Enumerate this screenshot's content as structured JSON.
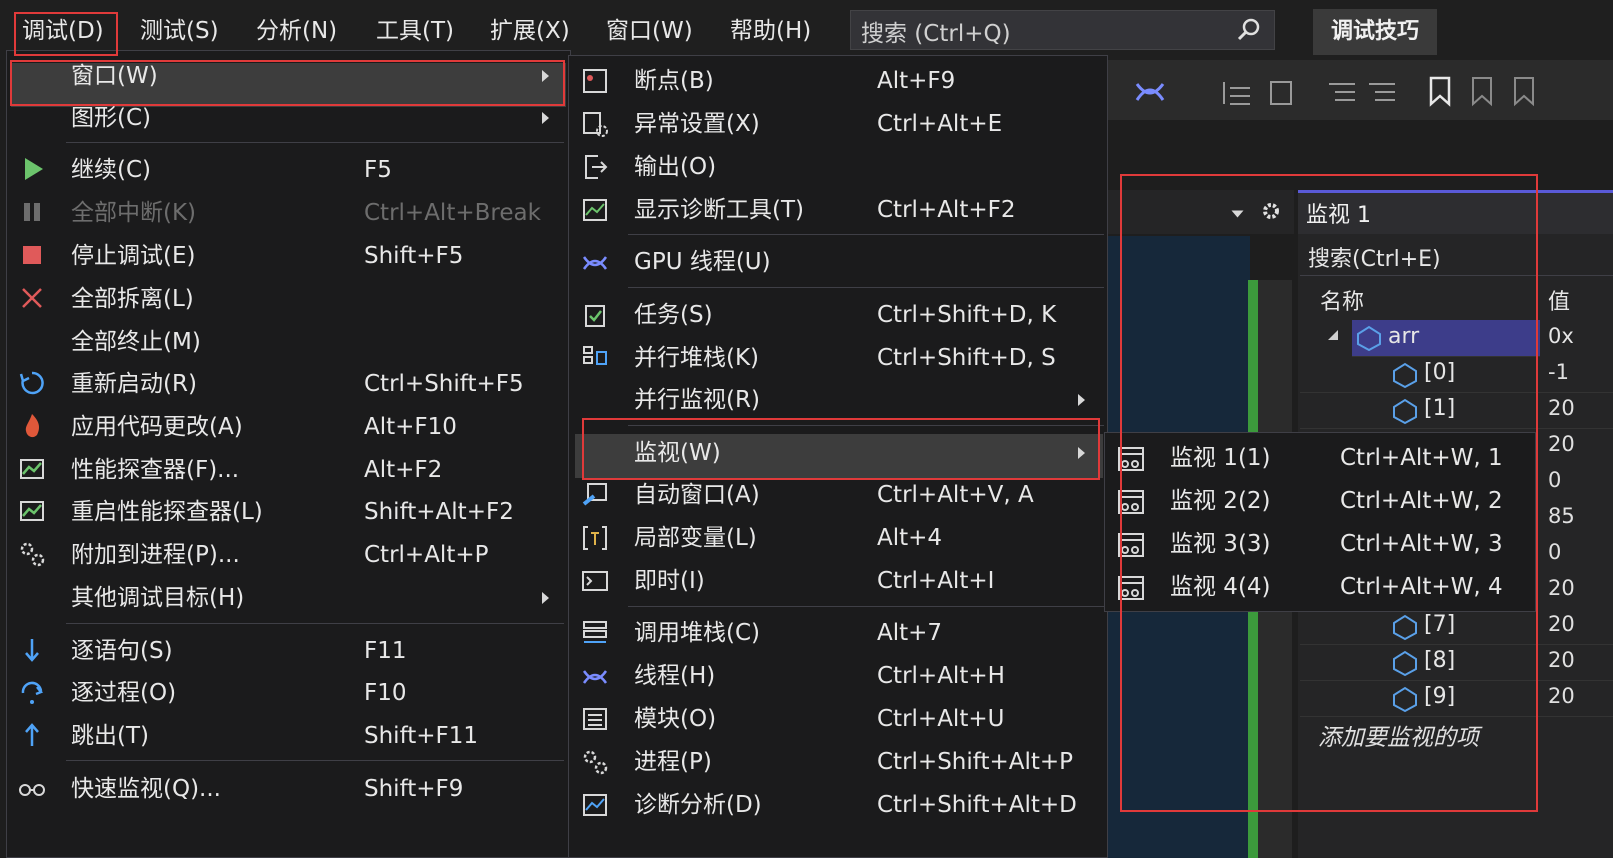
{
  "menubar": {
    "items": [
      "调试(D)",
      "测试(S)",
      "分析(N)",
      "工具(T)",
      "扩展(X)",
      "窗口(W)",
      "帮助(H)"
    ],
    "search_placeholder": "搜索 (Ctrl+Q)",
    "tips_button": "调试技巧"
  },
  "debug_menu": {
    "items": [
      {
        "label": "窗口(W)",
        "shortcut": "",
        "submenu": true,
        "icon": "none"
      },
      {
        "label": "图形(C)",
        "shortcut": "",
        "submenu": true,
        "icon": "none"
      },
      {
        "label": "继续(C)",
        "shortcut": "F5",
        "icon": "play-icon"
      },
      {
        "label": "全部中断(K)",
        "shortcut": "Ctrl+Alt+Break",
        "disabled": true,
        "icon": "pause-icon"
      },
      {
        "label": "停止调试(E)",
        "shortcut": "Shift+F5",
        "icon": "stop-icon"
      },
      {
        "label": "全部拆离(L)",
        "shortcut": "",
        "icon": "detach-x-icon"
      },
      {
        "label": "全部终止(M)",
        "shortcut": "",
        "icon": "none"
      },
      {
        "label": "重新启动(R)",
        "shortcut": "Ctrl+Shift+F5",
        "icon": "restart-icon"
      },
      {
        "label": "应用代码更改(A)",
        "shortcut": "Alt+F10",
        "icon": "hot-reload-icon"
      },
      {
        "label": "性能探查器(F)...",
        "shortcut": "Alt+F2",
        "icon": "profiler-icon"
      },
      {
        "label": "重启性能探查器(L)",
        "shortcut": "Shift+Alt+F2",
        "icon": "profiler-restart-icon"
      },
      {
        "label": "附加到进程(P)...",
        "shortcut": "Ctrl+Alt+P",
        "icon": "gears-icon"
      },
      {
        "label": "其他调试目标(H)",
        "shortcut": "",
        "submenu": true,
        "icon": "none"
      },
      {
        "label": "逐语句(S)",
        "shortcut": "F11",
        "icon": "step-into-icon"
      },
      {
        "label": "逐过程(O)",
        "shortcut": "F10",
        "icon": "step-over-icon"
      },
      {
        "label": "跳出(T)",
        "shortcut": "Shift+F11",
        "icon": "step-out-icon"
      },
      {
        "label": "快速监视(Q)...",
        "shortcut": "Shift+F9",
        "icon": "glasses-icon"
      }
    ]
  },
  "window_submenu": {
    "items": [
      {
        "label": "断点(B)",
        "shortcut": "Alt+F9",
        "icon": "breakpoints-icon"
      },
      {
        "label": "异常设置(X)",
        "shortcut": "Ctrl+Alt+E",
        "icon": "exception-settings-icon"
      },
      {
        "label": "输出(O)",
        "shortcut": "",
        "icon": "output-icon"
      },
      {
        "label": "显示诊断工具(T)",
        "shortcut": "Ctrl+Alt+F2",
        "icon": "diagnostics-icon"
      },
      {
        "label": "GPU 线程(U)",
        "shortcut": "",
        "icon": "gpu-threads-icon"
      },
      {
        "label": "任务(S)",
        "shortcut": "Ctrl+Shift+D, K",
        "icon": "tasks-icon"
      },
      {
        "label": "并行堆栈(K)",
        "shortcut": "Ctrl+Shift+D, S",
        "icon": "parallel-stacks-icon"
      },
      {
        "label": "并行监视(R)",
        "shortcut": "",
        "submenu": true,
        "icon": "none"
      },
      {
        "label": "监视(W)",
        "shortcut": "",
        "submenu": true,
        "icon": "none"
      },
      {
        "label": "自动窗口(A)",
        "shortcut": "Ctrl+Alt+V, A",
        "icon": "autos-icon"
      },
      {
        "label": "局部变量(L)",
        "shortcut": "Alt+4",
        "icon": "locals-icon"
      },
      {
        "label": "即时(I)",
        "shortcut": "Ctrl+Alt+I",
        "icon": "immediate-icon"
      },
      {
        "label": "调用堆栈(C)",
        "shortcut": "Alt+7",
        "icon": "call-stack-icon"
      },
      {
        "label": "线程(H)",
        "shortcut": "Ctrl+Alt+H",
        "icon": "threads-icon"
      },
      {
        "label": "模块(O)",
        "shortcut": "Ctrl+Alt+U",
        "icon": "modules-icon"
      },
      {
        "label": "进程(P)",
        "shortcut": "Ctrl+Shift+Alt+P",
        "icon": "processes-icon"
      },
      {
        "label": "诊断分析(D)",
        "shortcut": "Ctrl+Shift+Alt+D",
        "icon": "diagnostic-analysis-icon"
      }
    ]
  },
  "watch_submenu": {
    "items": [
      {
        "label": "监视 1(1)",
        "shortcut": "Ctrl+Alt+W, 1"
      },
      {
        "label": "监视 2(2)",
        "shortcut": "Ctrl+Alt+W, 2"
      },
      {
        "label": "监视 3(3)",
        "shortcut": "Ctrl+Alt+W, 3"
      },
      {
        "label": "监视 4(4)",
        "shortcut": "Ctrl+Alt+W, 4"
      }
    ]
  },
  "watch_panel": {
    "title": "监视 1",
    "search": "搜索(Ctrl+E)",
    "col_name": "名称",
    "col_value": "值",
    "root": "arr",
    "root_value": "0x",
    "rows": [
      {
        "name": "[0]",
        "value": "-1"
      },
      {
        "name": "[1]",
        "value": "20"
      },
      {
        "name": "[7]",
        "value": "20"
      },
      {
        "name": "[8]",
        "value": "20"
      },
      {
        "name": "[9]",
        "value": "20"
      }
    ],
    "hidden_values": [
      "20",
      "0",
      "85",
      "0",
      "20"
    ],
    "add_item": "添加要监视的项"
  },
  "colors": {
    "highlight_border": "#e03a3a",
    "menu_bg": "#1b1b1c",
    "accent": "#5a5ad8"
  }
}
